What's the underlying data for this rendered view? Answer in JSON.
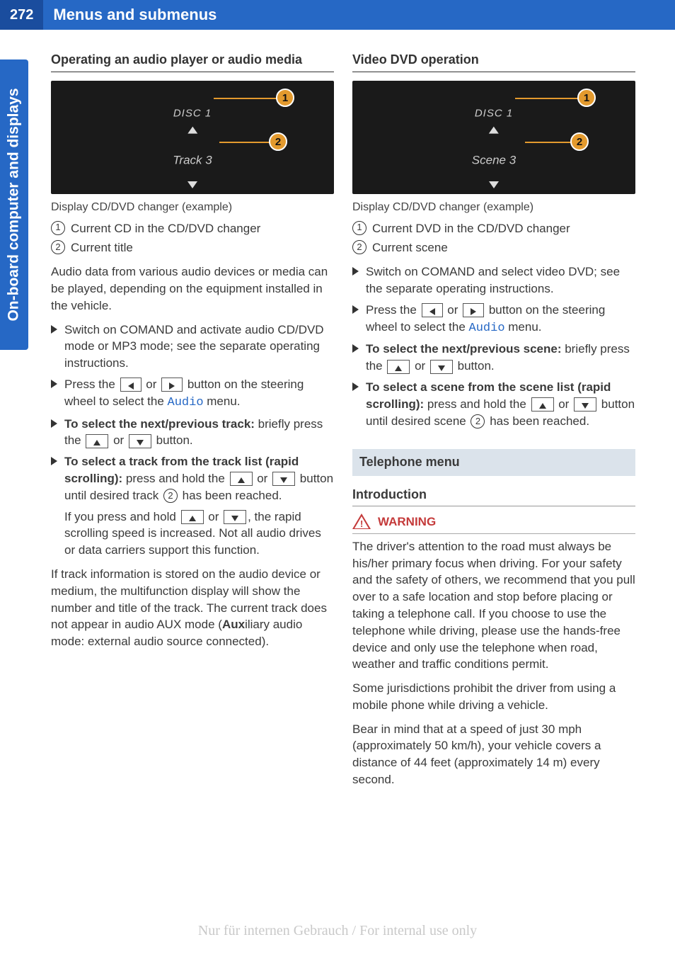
{
  "page": {
    "number": "272",
    "header_title": "Menus and submenus",
    "side_tab": "On-board computer and displays"
  },
  "left": {
    "h3": "Operating an audio player or audio media",
    "dash": {
      "line1": "DISC 1",
      "line2": "Track 3"
    },
    "caption": "Display CD/DVD changer (example)",
    "enum1": "Current CD in the CD/DVD changer",
    "enum2": "Current title",
    "para1": "Audio data from various audio devices or media can be played, depending on the equipment installed in the vehicle.",
    "step1": "Switch on COMAND and activate audio CD/DVD mode or MP3 mode; see the separate operating instructions.",
    "step2a": "Press the ",
    "step2b": " or ",
    "step2c": " button on the steering wheel to select the ",
    "step2menu": "Audio",
    "step2d": " menu.",
    "step3a": "To select the next/previous track:",
    "step3b": " briefly press the ",
    "step3c": " or ",
    "step3d": " button.",
    "step4a": "To select a track from the track list (rapid scrolling):",
    "step4b": " press and hold the ",
    "step4c": " or ",
    "step4d": " button until desired track ",
    "step4e": " has been reached.",
    "step4note_a": "If you press and hold ",
    "step4note_b": " or ",
    "step4note_c": ", the rapid scrolling speed is increased. Not all audio drives or data carriers support this function.",
    "para2_a": "If track information is stored on the audio device or medium, the multifunction display will show the number and title of the track. The current track does not appear in audio AUX mode (",
    "para2_aux": "Aux",
    "para2_b": "iliary audio mode: external audio source connected)."
  },
  "right": {
    "h3": "Video DVD operation",
    "dash": {
      "line1": "DISC 1",
      "line2": "Scene 3"
    },
    "caption": "Display CD/DVD changer (example)",
    "enum1": "Current DVD in the CD/DVD changer",
    "enum2": "Current scene",
    "step1": "Switch on COMAND and select video DVD; see the separate operating instructions.",
    "step2a": "Press the ",
    "step2b": " or ",
    "step2c": " button on the steering wheel to select the ",
    "step2menu": "Audio",
    "step2d": " menu.",
    "step3a": "To select the next/previous scene:",
    "step3b": " briefly press the ",
    "step3c": " or ",
    "step3d": " button.",
    "step4a": "To select a scene from the scene list (rapid scrolling):",
    "step4b": " press and hold the ",
    "step4c": " or ",
    "step4d": " button until desired scene ",
    "step4e": " has been reached.",
    "section_title": "Telephone menu",
    "sub_h3": "Introduction",
    "warn_label": "WARNING",
    "warn_p1": "The driver's attention to the road must always be his/her primary focus when driving. For your safety and the safety of others, we recommend that you pull over to a safe location and stop before placing or taking a telephone call. If you choose to use the telephone while driving, please use the hands-free device and only use the telephone when road, weather and traffic conditions permit.",
    "warn_p2": "Some jurisdictions prohibit the driver from using a mobile phone while driving a vehicle.",
    "warn_p3": "Bear in mind that at a speed of just 30 mph (approximately 50 km/h), your vehicle covers a distance of 44 feet (approximately 14 m) every second."
  },
  "footer": {
    "watermark": "Nur für internen Gebrauch / For internal use only"
  }
}
